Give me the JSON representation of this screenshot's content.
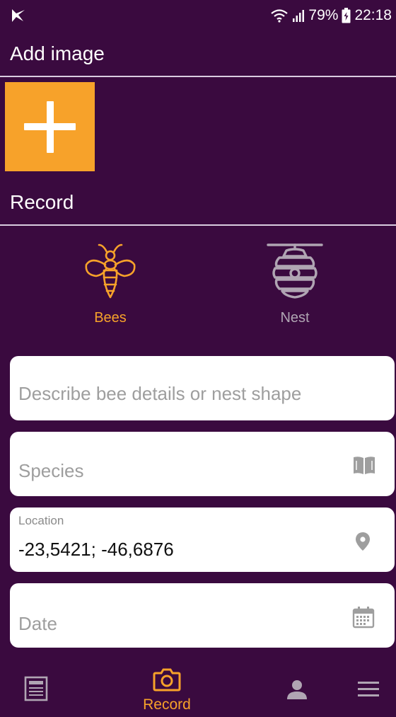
{
  "status_bar": {
    "battery": "79%",
    "time": "22:18"
  },
  "sections": {
    "add_image_title": "Add image",
    "record_title": "Record"
  },
  "record_types": [
    {
      "label": "Bees",
      "icon": "bee-icon",
      "selected": true
    },
    {
      "label": "Nest",
      "icon": "beehive-icon",
      "selected": false
    }
  ],
  "form": {
    "describe_placeholder": "Describe bee details or nest shape",
    "species_placeholder": "Species",
    "location_label": "Location",
    "location_value": "-23,5421; -46,6876",
    "date_placeholder": "Date"
  },
  "nav": {
    "record_label": "Record"
  },
  "colors": {
    "background": "#3a0a3f",
    "accent": "#f7a22a",
    "inactive": "#b0a5b3",
    "field_bg": "#ffffff"
  }
}
